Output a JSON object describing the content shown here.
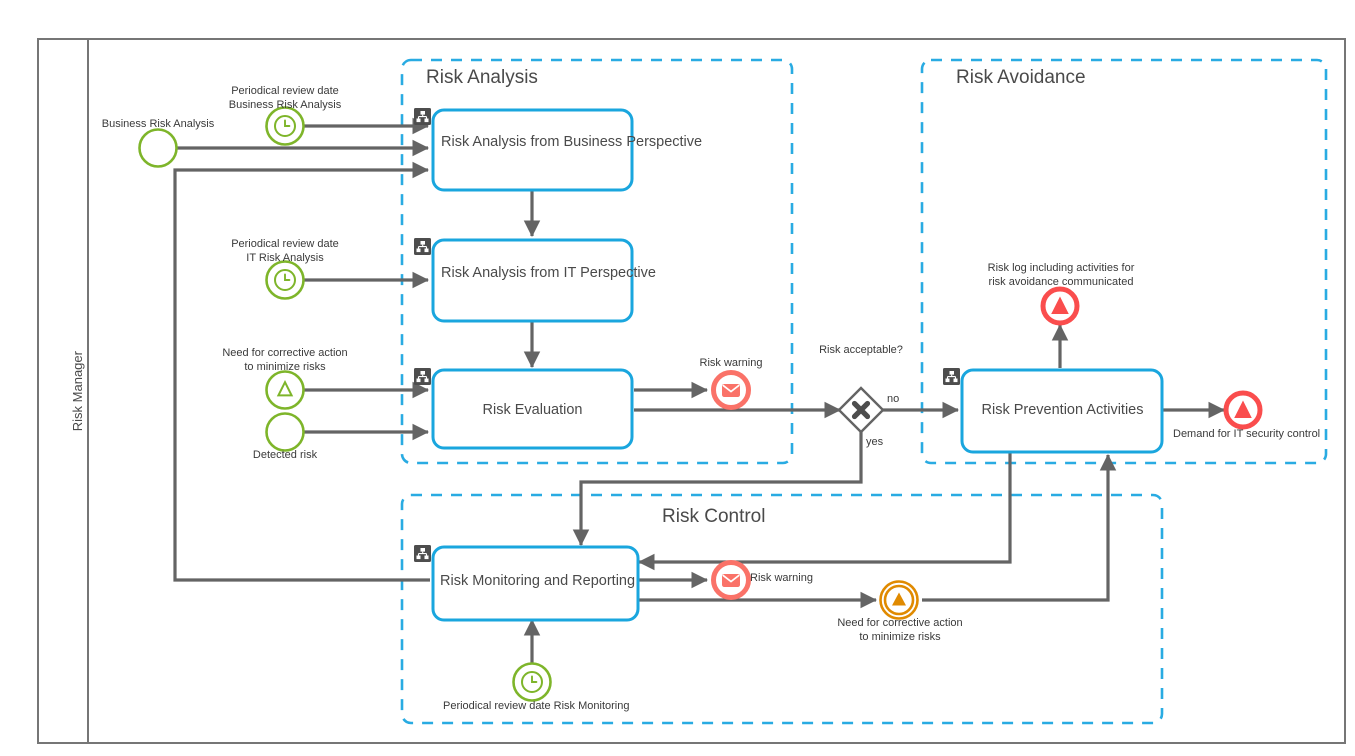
{
  "diagram": {
    "type": "bpmn-process-diagram",
    "pool": {
      "lane_label": "Risk Manager"
    },
    "colors": {
      "subprocess_border": "#29ABE2",
      "task_border": "#1AA6DE",
      "flow_line": "#646464",
      "start_event": "#7EB52A",
      "end_event_message": "#FA7268",
      "end_event_escalation": "#FA4D4D",
      "intermediate_escalation": "#E08A00",
      "pool_border": "#767676",
      "text": "#3a3a3a"
    },
    "subprocesses": [
      {
        "id": "risk-analysis",
        "title": "Risk Analysis"
      },
      {
        "id": "risk-avoidance",
        "title": "Risk Avoidance"
      },
      {
        "id": "risk-control",
        "title": "Risk Control"
      }
    ],
    "tasks": [
      {
        "id": "task-business",
        "label": "Risk Analysis from Business Perspective",
        "marker": "subprocess-marker"
      },
      {
        "id": "task-it",
        "label": "Risk Analysis from IT Perspective",
        "marker": "subprocess-marker"
      },
      {
        "id": "task-evaluation",
        "label": "Risk Evaluation",
        "marker": "subprocess-marker"
      },
      {
        "id": "task-prevention",
        "label": "Risk Prevention Activities",
        "marker": "subprocess-marker"
      },
      {
        "id": "task-monitoring",
        "label": "Risk Monitoring and Reporting",
        "marker": "subprocess-marker"
      }
    ],
    "events": [
      {
        "id": "ev-business-risk",
        "kind": "start-none",
        "label": "Business Risk Analysis"
      },
      {
        "id": "ev-timer-business",
        "kind": "start-timer",
        "label": "Periodical review date\nBusiness Risk Analysis"
      },
      {
        "id": "ev-timer-it",
        "kind": "start-timer",
        "label": "Periodical review date\nIT Risk Analysis"
      },
      {
        "id": "ev-corrective-start",
        "kind": "start-escalation",
        "label": "Need for corrective action\nto minimize risks"
      },
      {
        "id": "ev-detected-risk",
        "kind": "start-none",
        "label": "Detected risk"
      },
      {
        "id": "ev-timer-monitoring",
        "kind": "start-timer",
        "label": "Periodical review date Risk Monitoring"
      },
      {
        "id": "ev-warning-eval",
        "kind": "end-message",
        "label": "Risk warning"
      },
      {
        "id": "ev-warning-monitor",
        "kind": "end-message",
        "label": "Risk warning"
      },
      {
        "id": "ev-risk-log",
        "kind": "end-escalation",
        "label": "Risk log including activities for\nrisk avoidance communicated"
      },
      {
        "id": "ev-demand-it",
        "kind": "end-escalation",
        "label": "Demand for IT security control"
      },
      {
        "id": "ev-corrective-throw",
        "kind": "intermediate-escalation",
        "label": "Need for corrective action\nto minimize risks"
      }
    ],
    "gateways": [
      {
        "id": "gw-acceptable",
        "kind": "exclusive",
        "label": "Risk acceptable?",
        "branches": [
          {
            "label": "no"
          },
          {
            "label": "yes"
          }
        ]
      }
    ]
  }
}
